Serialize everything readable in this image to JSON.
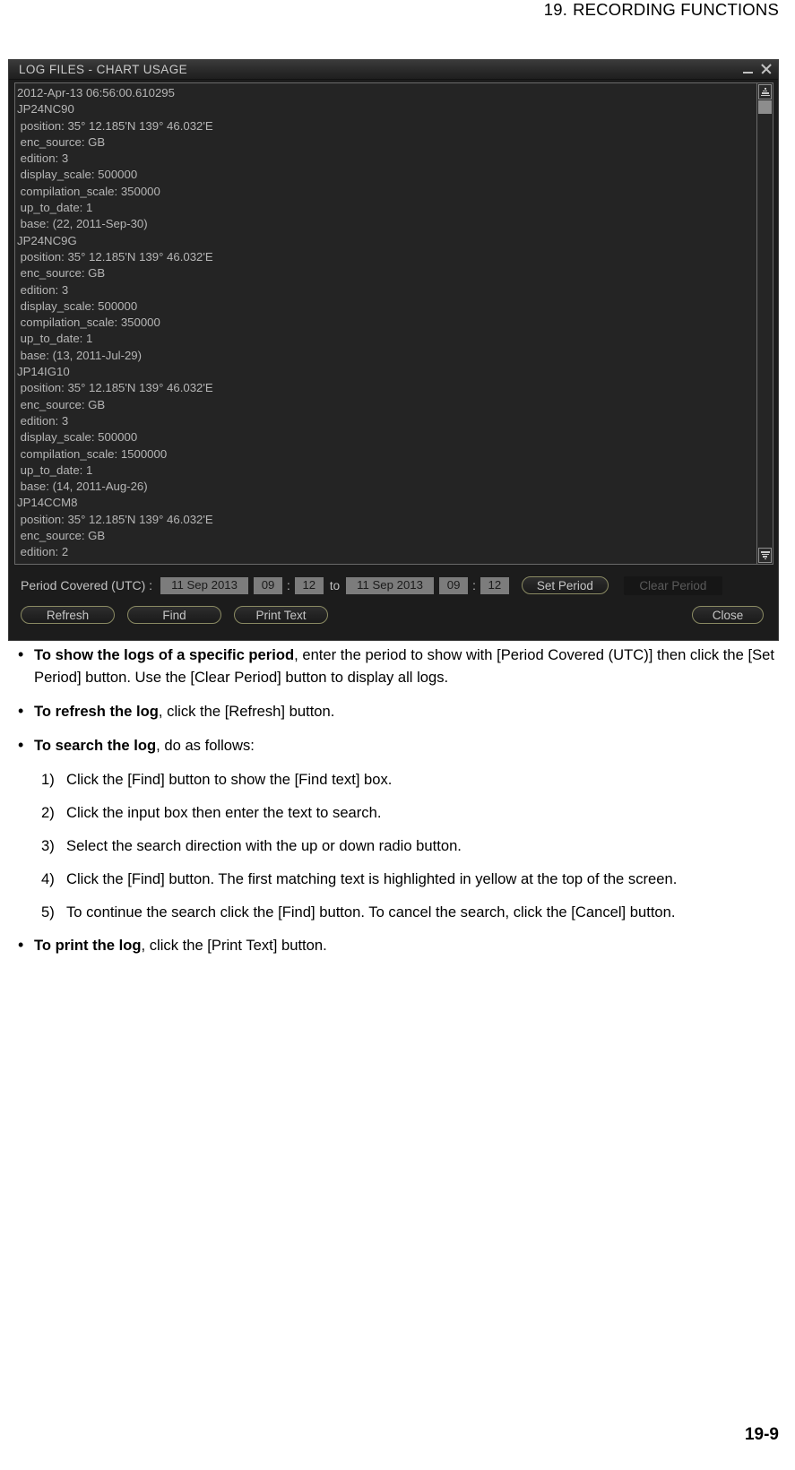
{
  "page": {
    "header_number": "19.",
    "header_title": "RECORDING FUNCTIONS",
    "footer": "19-9"
  },
  "dialog": {
    "title": "LOG FILES - CHART USAGE",
    "window_controls": {
      "minimize": "minimize-icon",
      "close": "close-icon"
    },
    "log_text": "2012-Apr-13 06:56:00.610295\nJP24NC90\n position: 35° 12.185'N 139° 46.032'E\n enc_source: GB\n edition: 3\n display_scale: 500000\n compilation_scale: 350000\n up_to_date: 1\n base: (22, 2011-Sep-30)\nJP24NC9G\n position: 35° 12.185'N 139° 46.032'E\n enc_source: GB\n edition: 3\n display_scale: 500000\n compilation_scale: 350000\n up_to_date: 1\n base: (13, 2011-Jul-29)\nJP14IG10\n position: 35° 12.185'N 139° 46.032'E\n enc_source: GB\n edition: 3\n display_scale: 500000\n compilation_scale: 1500000\n up_to_date: 1\n base: (14, 2011-Aug-26)\nJP14CCM8\n position: 35° 12.185'N 139° 46.032'E\n enc_source: GB\n edition: 2\n display_scale: 500000",
    "scrollbar": {
      "up_arrow": "scroll-up-icon",
      "down_arrow": "scroll-down-icon"
    },
    "period": {
      "label": "Period Covered (UTC) :",
      "from_date": "11 Sep 2013",
      "from_hour": "09",
      "from_minute": "12",
      "to_word": "to",
      "to_date": "11 Sep 2013",
      "to_hour": "09",
      "to_minute": "12",
      "colon": ":",
      "set_period_label": "Set Period",
      "clear_period_label": "Clear Period"
    },
    "buttons": {
      "refresh": "Refresh",
      "find": "Find",
      "print_text": "Print Text",
      "close": "Close"
    }
  },
  "content": {
    "bullets": [
      {
        "bold": "To show the logs of a specific period",
        "rest": ", enter the period to show with [Period Covered (UTC)] then click the [Set Period] button. Use the [Clear Period] button to display all logs."
      },
      {
        "bold": "To refresh the log",
        "rest": ", click the [Refresh] button."
      },
      {
        "bold": "To search the log",
        "rest": ", do as follows:"
      },
      {
        "bold": "To print the log",
        "rest": ", click the [Print Text] button."
      }
    ],
    "steps": [
      {
        "num": "1)",
        "text": "Click the [Find] button to show the [Find text] box."
      },
      {
        "num": "2)",
        "text": "Click the input box then enter the text to search."
      },
      {
        "num": "3)",
        "text": "Select the search direction with the up or down radio button."
      },
      {
        "num": "4)",
        "text": "Click the [Find] button. The first matching text is highlighted in yellow at the top of the screen."
      },
      {
        "num": "5)",
        "text": "To continue the search click the [Find] button. To cancel the search, click the [Cancel] button."
      }
    ],
    "bullet_mark": "•"
  }
}
